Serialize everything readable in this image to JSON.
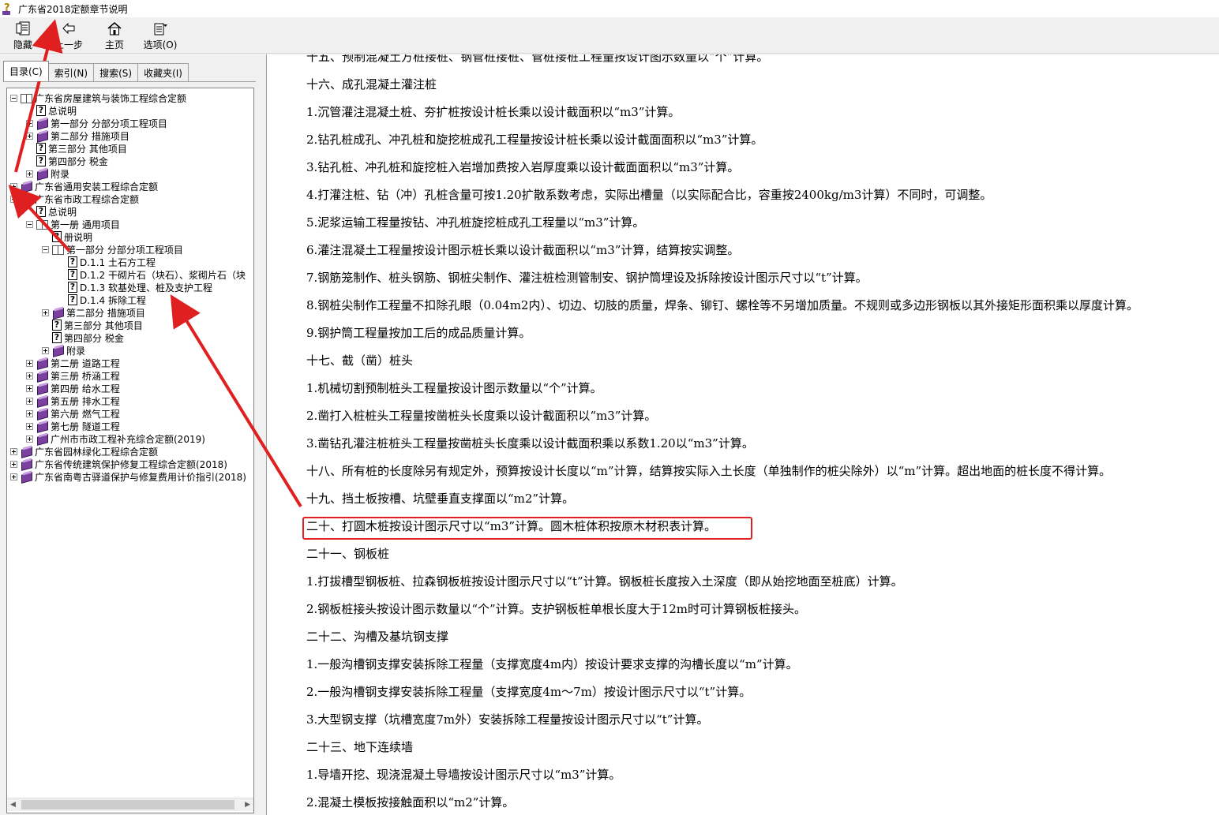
{
  "window": {
    "title": "广东省2018定额章节说明"
  },
  "toolbar": {
    "hide_label": "隐藏",
    "back_label": "上一步",
    "home_label": "主页",
    "options_label": "选项(O)"
  },
  "tabs": [
    {
      "label": "目录(C)"
    },
    {
      "label": "索引(N)"
    },
    {
      "label": "搜索(S)"
    },
    {
      "label": "收藏夹(I)"
    }
  ],
  "tree": [
    {
      "label": "广东省房屋建筑与装饰工程综合定额",
      "expanded": true,
      "icon": "openbook-icon"
    },
    {
      "label": "总说明",
      "icon": "help-page-icon"
    },
    {
      "label": "第一部分 分部分项工程项目",
      "icon": "book-icon"
    },
    {
      "label": "第二部分 措施项目",
      "icon": "book-icon"
    },
    {
      "label": "第三部分 其他项目",
      "icon": "help-page-icon"
    },
    {
      "label": "第四部分 税金",
      "icon": "help-page-icon"
    },
    {
      "label": "附录",
      "icon": "book-icon"
    },
    {
      "label": "广东省通用安装工程综合定额",
      "icon": "book-icon"
    },
    {
      "label": "广东省市政工程综合定额",
      "expanded": true,
      "icon": "openbook-icon"
    },
    {
      "label": "总说明",
      "icon": "help-page-icon"
    },
    {
      "label": "第一册 通用项目",
      "expanded": true,
      "icon": "openbook-icon"
    },
    {
      "label": "册说明",
      "icon": "help-page-icon"
    },
    {
      "label": "第一部分 分部分项工程项目",
      "expanded": true,
      "icon": "openbook-icon"
    },
    {
      "label": "D.1.1 土石方工程",
      "icon": "help-page-icon"
    },
    {
      "label": "D.1.2 干砌片石（块石）、浆砌片石（块",
      "icon": "help-page-icon"
    },
    {
      "label": "D.1.3 软基处理、桩及支护工程",
      "icon": "help-page-icon"
    },
    {
      "label": "D.1.4 拆除工程",
      "icon": "help-page-icon"
    },
    {
      "label": "第二部分 措施项目",
      "icon": "book-icon"
    },
    {
      "label": "第三部分 其他项目",
      "icon": "help-page-icon"
    },
    {
      "label": "第四部分 税金",
      "icon": "help-page-icon"
    },
    {
      "label": "附录",
      "icon": "book-icon"
    },
    {
      "label": "第二册 道路工程",
      "icon": "book-icon"
    },
    {
      "label": "第三册 桥涵工程",
      "icon": "book-icon"
    },
    {
      "label": "第四册 给水工程",
      "icon": "book-icon"
    },
    {
      "label": "第五册 排水工程",
      "icon": "book-icon"
    },
    {
      "label": "第六册 燃气工程",
      "icon": "book-icon"
    },
    {
      "label": "第七册 隧道工程",
      "icon": "book-icon"
    },
    {
      "label": "广州市市政工程补充综合定额(2019)",
      "icon": "book-icon"
    },
    {
      "label": "广东省园林绿化工程综合定额",
      "icon": "book-icon"
    },
    {
      "label": "广东省传统建筑保护修复工程综合定额(2018)",
      "icon": "book-icon"
    },
    {
      "label": "广东省南粤古驿道保护与修复费用计价指引(2018)",
      "icon": "book-icon"
    }
  ],
  "content": {
    "lines": [
      "十五、预制混凝土方桩接桩、钢管桩接桩、管桩接桩工程量按设计图示数量以“个”计算。",
      "十六、成孔混凝土灌注桩",
      "1.沉管灌注混凝土桩、夯扩桩按设计桩长乘以设计截面积以“m3”计算。",
      "2.钻孔桩成孔、冲孔桩和旋挖桩成孔工程量按设计桩长乘以设计截面面积以“m3”计算。",
      "3.钻孔桩、冲孔桩和旋挖桩入岩增加费按入岩厚度乘以设计截面面积以“m3”计算。",
      "4.打灌注桩、钻（冲）孔桩含量可按1.20扩散系数考虑，实际出槽量（以实际配合比，容重按2400kg/m3计算）不同时，可调整。",
      "5.泥浆运输工程量按钻、冲孔桩旋挖桩成孔工程量以“m3”计算。",
      "6.灌注混凝土工程量按设计图示桩长乘以设计截面积以“m3”计算，结算按实调整。",
      "7.钢筋笼制作、桩头钢筋、钢桩尖制作、灌注桩检测管制安、钢护筒埋设及拆除按设计图示尺寸以“t”计算。",
      "8.钢桩尖制作工程量不扣除孔眼（0.04m2内）、切边、切肢的质量，焊条、铆钉、螺栓等不另增加质量。不规则或多边形钢板以其外接矩形面积乘以厚度计算。",
      "9.钢护筒工程量按加工后的成品质量计算。",
      "十七、截（凿）桩头",
      "1.机械切割预制桩头工程量按设计图示数量以“个”计算。",
      "2.凿打入桩桩头工程量按凿桩头长度乘以设计截面积以“m3”计算。",
      "3.凿钻孔灌注桩桩头工程量按凿桩头长度乘以设计截面积乘以系数1.20以“m3”计算。",
      "十八、所有桩的长度除另有规定外，预算按设计长度以“m”计算，结算按实际入土长度（单独制作的桩尖除外）以“m”计算。超出地面的桩长度不得计算。",
      "十九、挡土板按槽、坑壁垂直支撑面以“m2”计算。",
      "二十、打圆木桩按设计图示尺寸以“m3”计算。圆木桩体积按原木材积表计算。",
      "二十一、钢板桩",
      "1.打拔槽型钢板桩、拉森钢板桩按设计图示尺寸以“t”计算。钢板桩长度按入土深度（即从始挖地面至桩底）计算。",
      "2.钢板桩接头按设计图示数量以“个”计算。支护钢板桩单根长度大于12m时可计算钢板桩接头。",
      "二十二、沟槽及基坑钢支撑",
      "1.一般沟槽钢支撑安装拆除工程量（支撑宽度4m内）按设计要求支撑的沟槽长度以“m”计算。",
      "2.一般沟槽钢支撑安装拆除工程量（支撑宽度4m～7m）按设计图示尺寸以“t”计算。",
      "3.大型钢支撑（坑槽宽度7m外）安装拆除工程量按设计图示尺寸以“t”计算。",
      "二十三、地下连续墙",
      "1.导墙开挖、现浇混凝土导墙按设计图示尺寸以“m3”计算。",
      "2.混凝土模板按接触面积以“m2”计算。"
    ]
  },
  "colors": {
    "annotation_red": "#e02020",
    "book_purple": "#7b3fa0"
  }
}
